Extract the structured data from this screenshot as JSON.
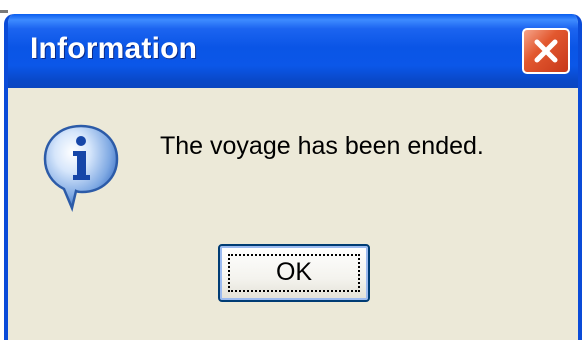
{
  "window": {
    "title": "Information",
    "close_icon": "close-icon"
  },
  "dialog": {
    "icon": "information-icon",
    "message": "The voyage has been ended.",
    "ok_label": "OK"
  },
  "colors": {
    "titlebar": "#0a55e6",
    "body": "#ece9d8",
    "close_button": "#e2582f",
    "icon_bubble": "#3a7fe0"
  }
}
